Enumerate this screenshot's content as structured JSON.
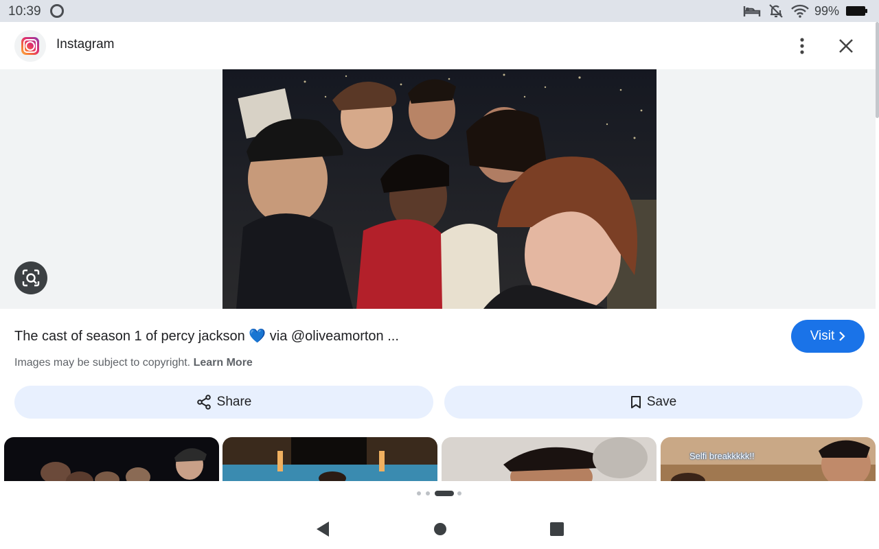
{
  "status_bar": {
    "time": "10:39",
    "battery_percent": "99%",
    "icons": [
      "circle-icon",
      "bed-icon",
      "bell-off-icon",
      "wifi-icon",
      "battery-icon"
    ]
  },
  "header": {
    "app_name": "Instagram",
    "icons": [
      "instagram-logo-icon",
      "more-vert-icon",
      "close-icon"
    ]
  },
  "result": {
    "caption": "The cast of season 1 of percy jackson 💙 via @oliveamorton ...",
    "visit_label": "Visit",
    "copyright_text": "Images may be subject to copyright.",
    "learn_more_label": "Learn More",
    "share_label": "Share",
    "save_label": "Save"
  },
  "related_thumbs": [
    {
      "overlay_text": ""
    },
    {
      "overlay_text": ""
    },
    {
      "overlay_text": ""
    },
    {
      "overlay_text": "Selfi breakkkkk!!"
    }
  ],
  "pager": {
    "total_dots": 4,
    "active_index": 2
  },
  "colors": {
    "accent": "#1a73e8",
    "pill_bg": "#e8f0fe",
    "status_bar_bg": "#dfe3ea",
    "image_area_bg": "#f1f3f4"
  }
}
